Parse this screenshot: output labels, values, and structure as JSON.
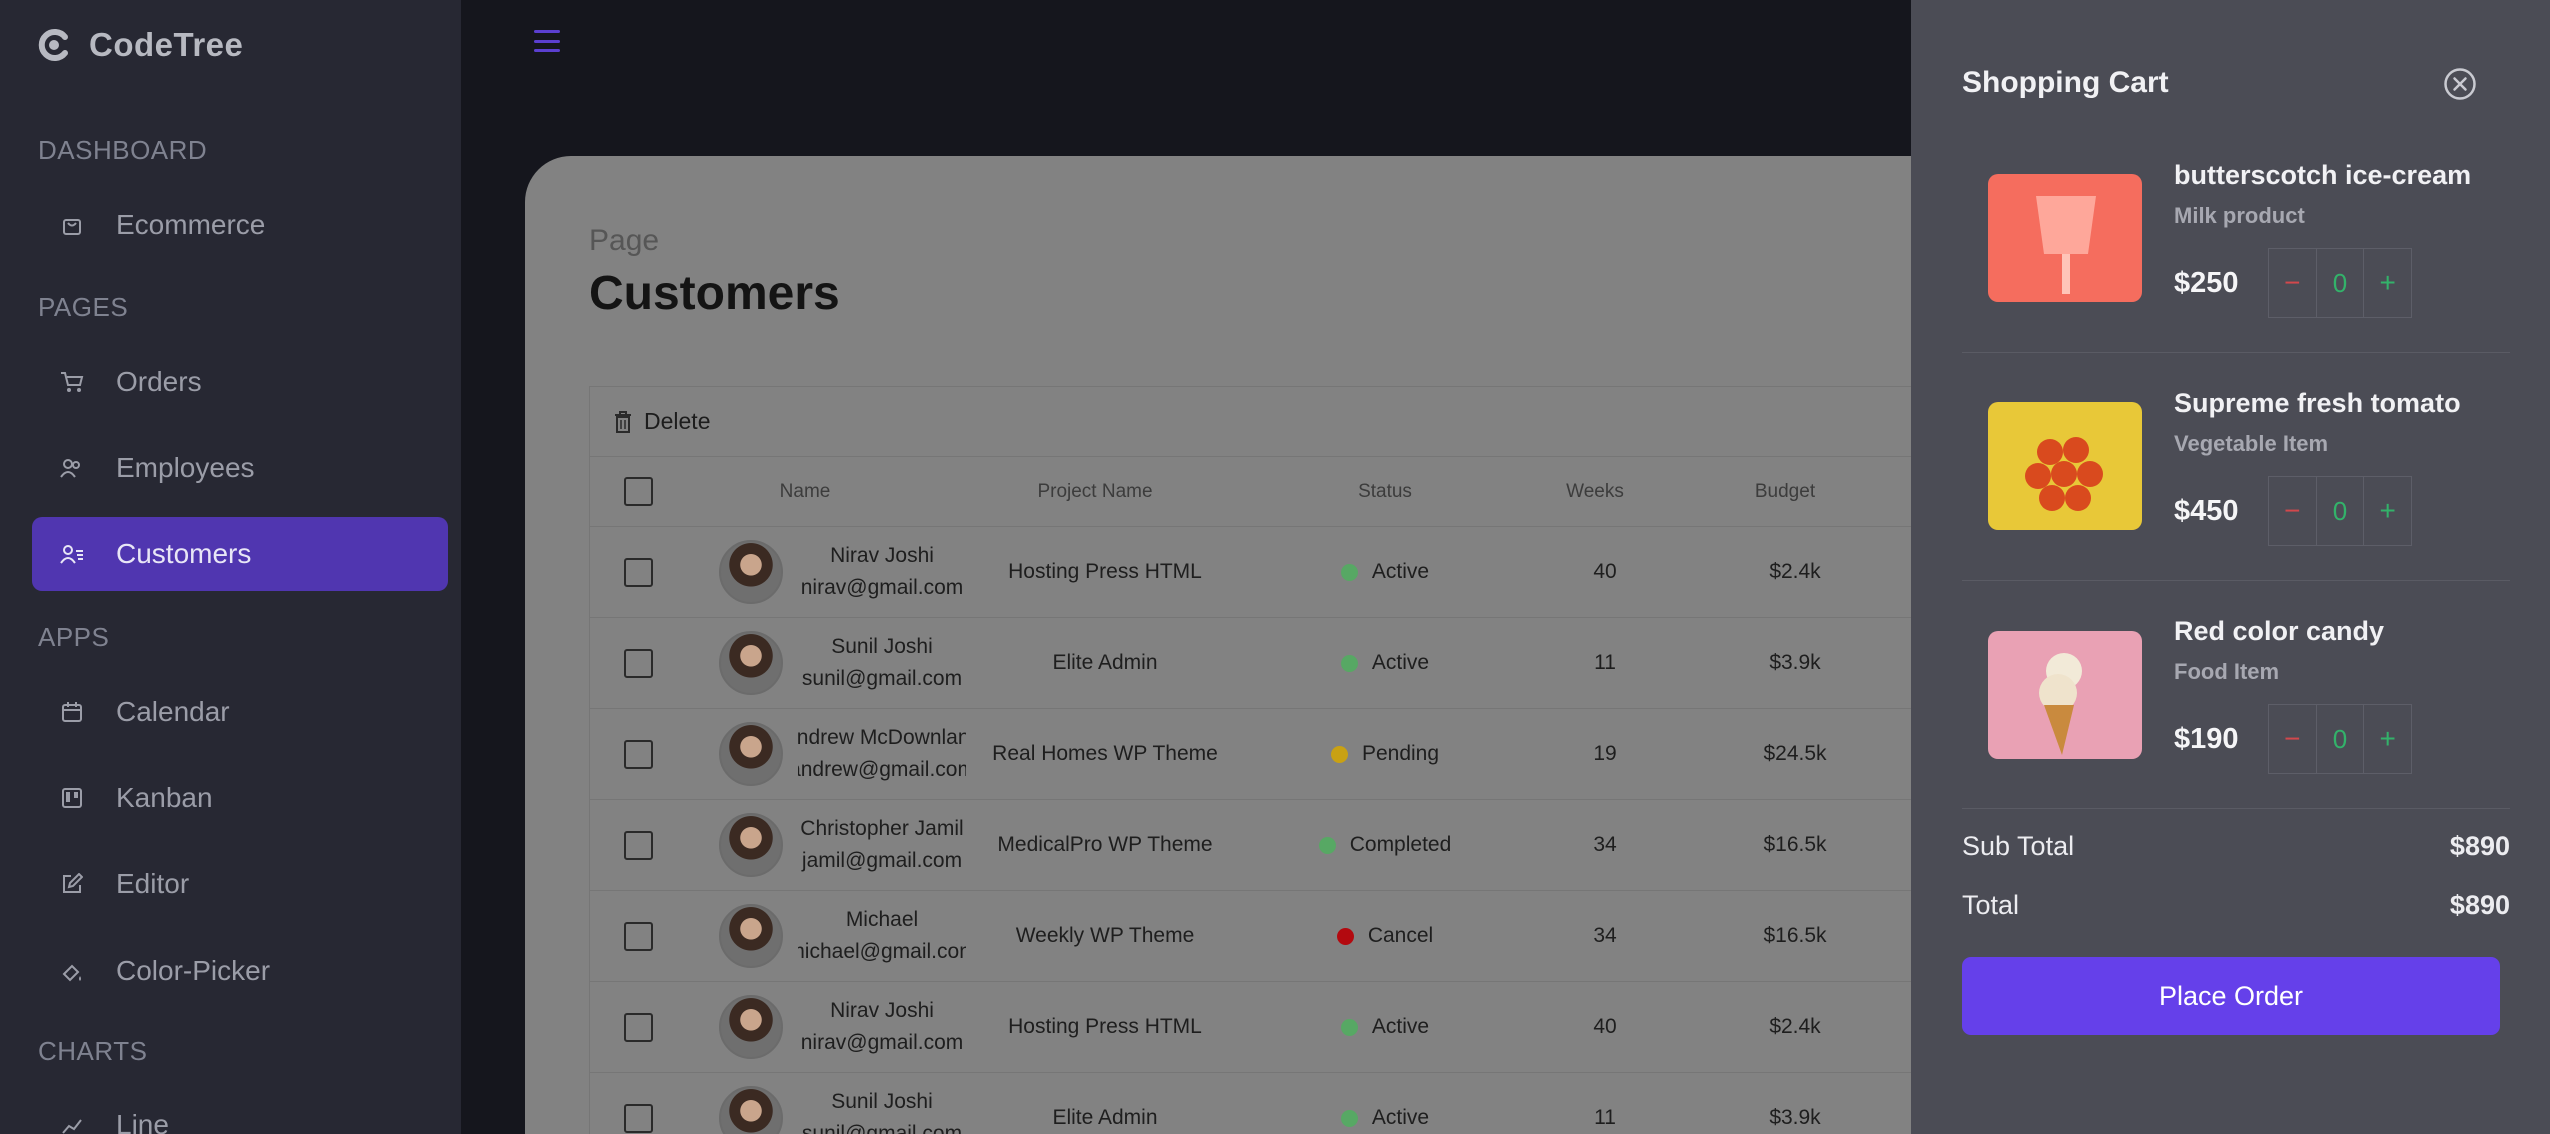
{
  "brand": {
    "name": "CodeTree"
  },
  "sidebar": {
    "sections": {
      "dashboard": "DASHBOARD",
      "pages": "PAGES",
      "apps": "APPS",
      "charts": "CHARTS"
    },
    "items": [
      {
        "label": "Ecommerce",
        "icon": "shopping-bag-icon"
      },
      {
        "label": "Orders",
        "icon": "cart-icon"
      },
      {
        "label": "Employees",
        "icon": "employees-icon"
      },
      {
        "label": "Customers",
        "icon": "customers-icon",
        "active": true
      },
      {
        "label": "Calendar",
        "icon": "calendar-icon"
      },
      {
        "label": "Kanban",
        "icon": "kanban-icon"
      },
      {
        "label": "Editor",
        "icon": "edit-icon"
      },
      {
        "label": "Color-Picker",
        "icon": "color-picker-icon"
      },
      {
        "label": "Line",
        "icon": "line-chart-icon"
      }
    ],
    "accent": "#5036b0"
  },
  "main": {
    "breadcrumb": "Page",
    "title": "Customers"
  },
  "table": {
    "delete_label": "Delete",
    "headers": {
      "name": "Name",
      "project": "Project Name",
      "status": "Status",
      "weeks": "Weeks",
      "budget": "Budget"
    },
    "rows": [
      {
        "name": "Nirav Joshi",
        "email": "nirav@gmail.com",
        "project": "Hosting Press HTML",
        "status": "Active",
        "status_color": "#57a864",
        "weeks": "40",
        "budget": "$2.4k"
      },
      {
        "name": "Sunil Joshi",
        "email": "sunil@gmail.com",
        "project": "Elite Admin",
        "status": "Active",
        "status_color": "#57a864",
        "weeks": "11",
        "budget": "$3.9k"
      },
      {
        "name": "Andrew McDownland",
        "email": "andrew@gmail.com",
        "project": "Real Homes WP Theme",
        "status": "Pending",
        "status_color": "#c9a113",
        "weeks": "19",
        "budget": "$24.5k"
      },
      {
        "name": "Christopher Jamil",
        "email": "jamil@gmail.com",
        "project": "MedicalPro WP Theme",
        "status": "Completed",
        "status_color": "#57a864",
        "weeks": "34",
        "budget": "$16.5k"
      },
      {
        "name": "Michael",
        "email": "michael@gmail.com",
        "project": "Weekly WP Theme",
        "status": "Cancel",
        "status_color": "#b3090f",
        "weeks": "34",
        "budget": "$16.5k"
      },
      {
        "name": "Nirav Joshi",
        "email": "nirav@gmail.com",
        "project": "Hosting Press HTML",
        "status": "Active",
        "status_color": "#57a864",
        "weeks": "40",
        "budget": "$2.4k"
      },
      {
        "name": "Sunil Joshi",
        "email": "sunil@gmail.com",
        "project": "Elite Admin",
        "status": "Active",
        "status_color": "#57a864",
        "weeks": "11",
        "budget": "$3.9k"
      }
    ]
  },
  "cart": {
    "title": "Shopping Cart",
    "items": [
      {
        "name": "butterscotch ice-cream",
        "category": "Milk product",
        "price": "$250",
        "qty": "0",
        "minus": "−",
        "plus": "+"
      },
      {
        "name": "Supreme fresh tomato",
        "category": "Vegetable Item",
        "price": "$450",
        "qty": "0",
        "minus": "−",
        "plus": "+"
      },
      {
        "name": "Red color candy",
        "category": "Food Item",
        "price": "$190",
        "qty": "0",
        "minus": "−",
        "plus": "+"
      }
    ],
    "subtotal_label": "Sub Total",
    "subtotal": "$890",
    "total_label": "Total",
    "total": "$890",
    "order_button": "Place Order",
    "accent": "#6540ea"
  }
}
